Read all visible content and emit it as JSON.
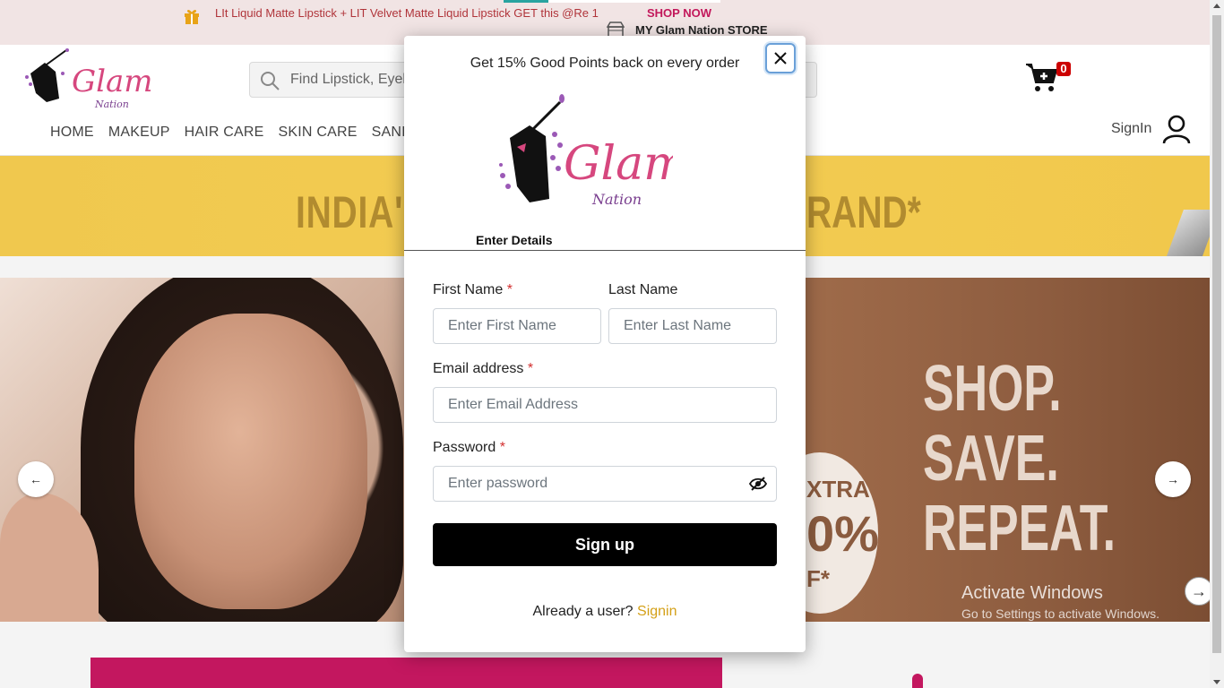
{
  "announcement": {
    "promo_text": "LIt Liquid Matte Lipstick + LIT Velvet Matte Liquid Lipstick GET this @Re 1",
    "shop_now": "SHOP NOW",
    "store_text": "MY Glam Nation STORE"
  },
  "header": {
    "logo_text": "Glam",
    "logo_subtext": "Nation",
    "search_placeholder": "Find Lipstick, Eyel",
    "cart_count": "0",
    "signin_label": "SignIn",
    "nav": [
      "HOME",
      "MAKEUP",
      "HAIR CARE",
      "SKIN CARE",
      "SANIT"
    ]
  },
  "banner": {
    "text_left": "INDIA'S N",
    "text_right": "RAND*"
  },
  "hero": {
    "extra_lines": [
      "XTRA",
      "0%",
      "F*"
    ],
    "slogan": [
      "SHOP.",
      "SAVE.",
      "REPEAT."
    ],
    "prev_arrow": "←",
    "next_arrow": "→"
  },
  "watermark": {
    "line1": "Activate Windows",
    "line2": "Go to Settings to activate Windows."
  },
  "modal": {
    "headline": "Get 15% Good Points back on every order",
    "logo_text": "Glam",
    "logo_subtext": "Nation",
    "section_title": "Enter Details",
    "first_name_label": "First Name",
    "first_name_placeholder": "Enter First Name",
    "last_name_label": "Last Name",
    "last_name_placeholder": "Enter Last Name",
    "email_label": "Email address",
    "email_placeholder": "Enter Email Address",
    "password_label": "Password",
    "password_placeholder": "Enter password",
    "required_mark": "*",
    "signup_label": "Sign up",
    "already_user": "Already a user?",
    "signin_link": "Signin"
  },
  "colors": {
    "brand_pink": "#c2185b",
    "link_gold": "#d4a017",
    "button_black": "#000000",
    "required_red": "#d32f2f"
  }
}
